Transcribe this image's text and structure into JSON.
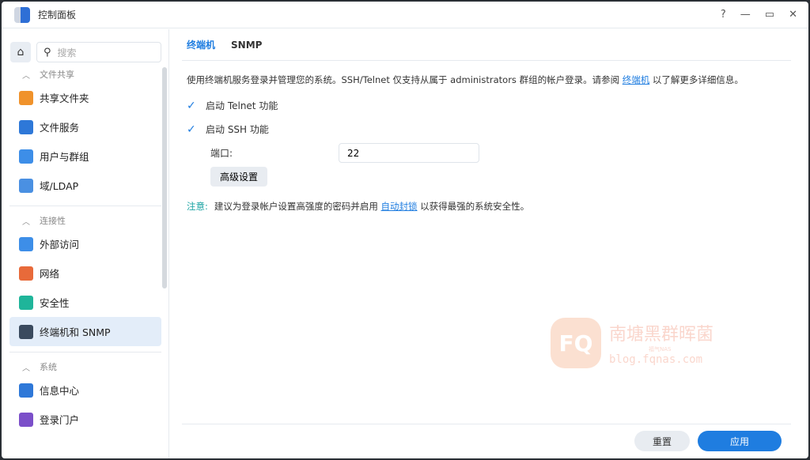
{
  "window": {
    "title": "控制面板",
    "help": "?",
    "minimize": "—",
    "maximize": "▭",
    "close": "✕"
  },
  "sidebar": {
    "search_placeholder": "搜索",
    "sections": [
      {
        "label": "文件共享",
        "items": [
          {
            "label": "共享文件夹",
            "color": "#f0922b"
          },
          {
            "label": "文件服务",
            "color": "#2e78d8"
          },
          {
            "label": "用户与群组",
            "color": "#3d8ee8"
          },
          {
            "label": "域/LDAP",
            "color": "#4a90e2"
          }
        ]
      },
      {
        "label": "连接性",
        "items": [
          {
            "label": "外部访问",
            "color": "#3d8ee8"
          },
          {
            "label": "网络",
            "color": "#e86a3a"
          },
          {
            "label": "安全性",
            "color": "#1fb59a"
          },
          {
            "label": "终端机和 SNMP",
            "color": "#3a4a5e"
          }
        ]
      },
      {
        "label": "系统",
        "items": [
          {
            "label": "信息中心",
            "color": "#2e78d8"
          },
          {
            "label": "登录门户",
            "color": "#7b4fc9"
          }
        ]
      }
    ]
  },
  "tabs": [
    "终端机",
    "SNMP"
  ],
  "terminal": {
    "desc_pre": "使用终端机服务登录并管理您的系统。SSH/Telnet 仅支持从属于 administrators 群组的帐户登录。请参阅 ",
    "desc_link": "终端机",
    "desc_post": " 以了解更多详细信息。",
    "telnet_label": "启动 Telnet 功能",
    "telnet_checked": true,
    "ssh_label": "启动 SSH 功能",
    "ssh_checked": true,
    "port_label": "端口:",
    "port_value": "22",
    "advanced_button": "高级设置",
    "note_label": "注意:",
    "note_pre": "建议为登录帐户设置高强度的密码并启用 ",
    "note_link": "自动封锁",
    "note_post": " 以获得最强的系统安全性。"
  },
  "watermark": {
    "logo": "FQ",
    "name": "南塘黑群晖菌",
    "sub": "福气NAS",
    "url": "blog.fqnas.com"
  },
  "footer": {
    "reset": "重置",
    "apply": "应用"
  }
}
